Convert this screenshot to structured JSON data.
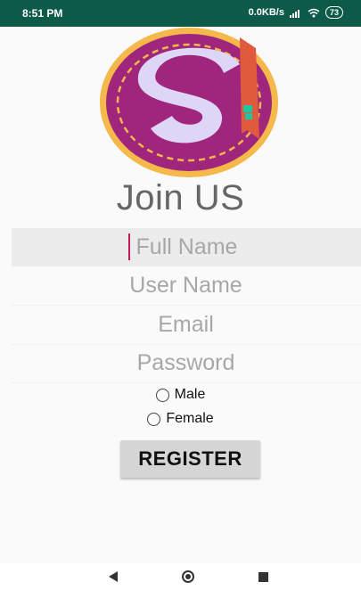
{
  "status_bar": {
    "time": "8:51 PM",
    "network_speed": "0.0KB/s",
    "battery": "73",
    "signal_icon": "signal-icon",
    "wifi_icon": "wifi-icon"
  },
  "logo": {
    "icon": "app-logo-s",
    "colors": {
      "ring": "#f5b84a",
      "badge": "#a0257c",
      "letter": "#ddd6f7",
      "bookmark": "#e05a3e"
    }
  },
  "form": {
    "title": "Join US",
    "full_name_placeholder": "Full Name",
    "user_name_placeholder": "User Name",
    "email_placeholder": "Email",
    "password_placeholder": "Password",
    "gender_options": [
      "Male",
      "Female"
    ],
    "register_label": "REGISTER"
  },
  "nav_bar": {
    "back_icon": "back-icon",
    "home_icon": "home-icon",
    "recents_icon": "recents-icon"
  },
  "colors": {
    "status_bar": "#0d5a49",
    "caret": "#c2185b",
    "button": "#d6d6d6"
  }
}
